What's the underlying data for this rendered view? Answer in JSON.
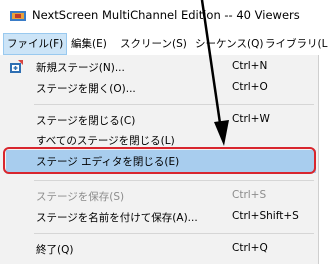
{
  "window": {
    "title": "NextScreen MultiChannel Edition -- 40 Viewers"
  },
  "menubar": {
    "items": [
      "ファイル(F)",
      "編集(E)",
      "スクリーン(S)",
      "シーケンス(Q)",
      "ライブラリ(L)"
    ]
  },
  "menu": {
    "items": [
      {
        "label": "新規ステージ(N)...",
        "shortcut": "Ctrl+N",
        "enabled": true
      },
      {
        "label": "ステージを開く(O)...",
        "shortcut": "Ctrl+O",
        "enabled": true
      },
      {
        "label": "ステージを閉じる(C)",
        "shortcut": "Ctrl+W",
        "enabled": true
      },
      {
        "label": "すべてのステージを閉じる(L)",
        "shortcut": "",
        "enabled": true
      },
      {
        "label": "ステージ エディタを閉じる(E)",
        "shortcut": "",
        "enabled": true,
        "highlighted": true
      },
      {
        "label": "ステージを保存(S)",
        "shortcut": "Ctrl+S",
        "enabled": false
      },
      {
        "label": "ステージを名前を付けて保存(A)...",
        "shortcut": "Ctrl+Shift+S",
        "enabled": true
      },
      {
        "label": "終了(Q)",
        "shortcut": "Ctrl+Q",
        "enabled": true
      }
    ]
  },
  "colors": {
    "highlight": "#a8cdee",
    "annotation_red": "#d8262e",
    "menu_bg": "#f2f2f2"
  }
}
